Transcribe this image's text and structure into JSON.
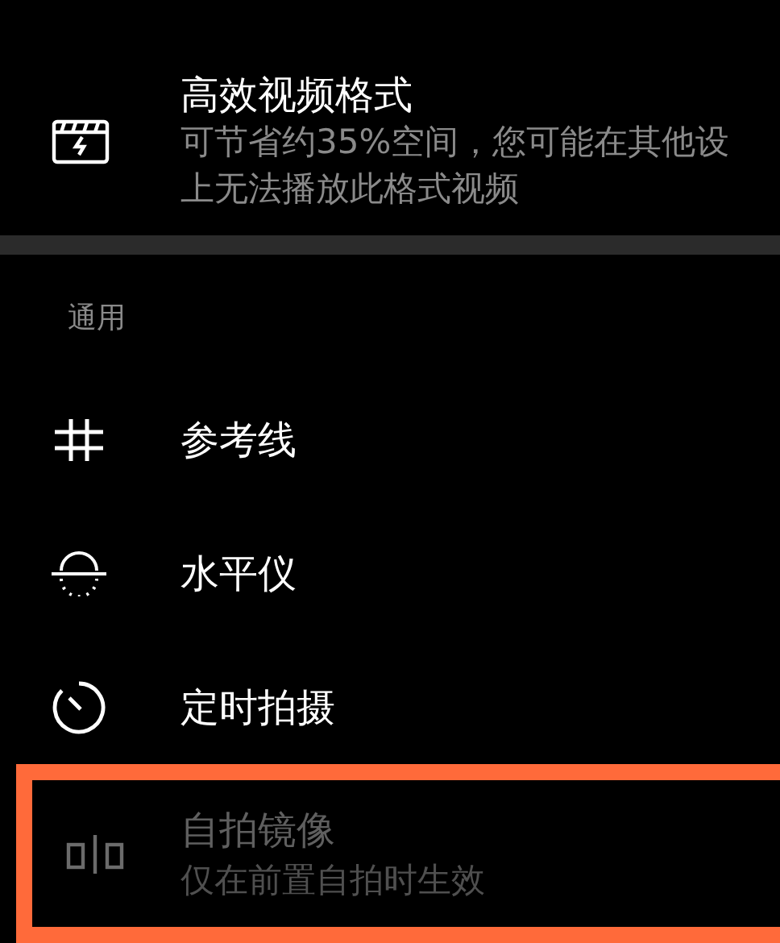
{
  "top_item": {
    "kind": "video_format",
    "title": "高效视频格式",
    "description_lines": [
      "可节省约35%空间，您可能在其他设",
      "上无法播放此格式视频"
    ]
  },
  "general": {
    "header": "通用",
    "items": [
      {
        "kind": "grid",
        "title": "参考线",
        "disabled": false,
        "highlighted": false
      },
      {
        "kind": "level",
        "title": "水平仪",
        "disabled": false,
        "highlighted": false
      },
      {
        "kind": "timer",
        "title": "定时拍摄",
        "disabled": false,
        "highlighted": false
      },
      {
        "kind": "mirror",
        "title": "自拍镜像",
        "subtitle": "仅在前置自拍时生效",
        "disabled": true,
        "highlighted": true
      }
    ]
  }
}
